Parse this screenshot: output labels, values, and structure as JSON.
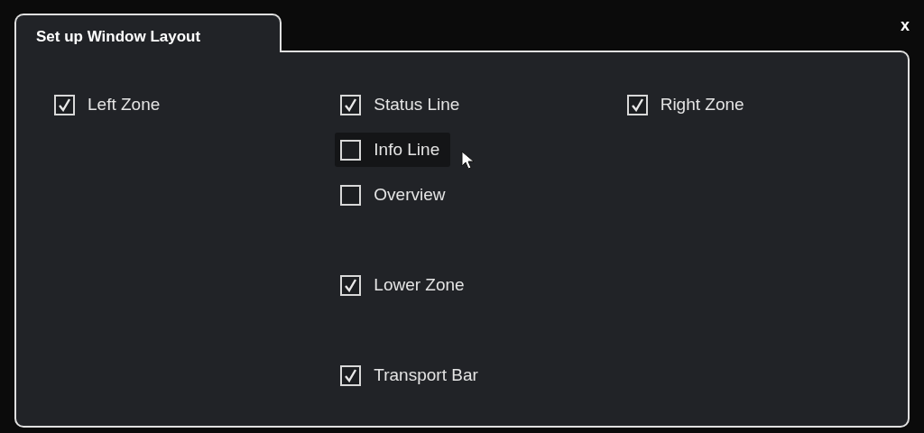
{
  "dialog": {
    "tab": "Set up Window Layout",
    "close": "x"
  },
  "columns": [
    {
      "groups": [
        [
          {
            "label": "Left Zone",
            "checked": true,
            "hovered": false
          }
        ]
      ]
    },
    {
      "groups": [
        [
          {
            "label": "Status Line",
            "checked": true,
            "hovered": false
          },
          {
            "label": "Info Line",
            "checked": false,
            "hovered": true
          },
          {
            "label": "Overview",
            "checked": false,
            "hovered": false
          }
        ],
        [
          {
            "label": "Lower Zone",
            "checked": true,
            "hovered": false
          }
        ],
        [
          {
            "label": "Transport Bar",
            "checked": true,
            "hovered": false
          }
        ]
      ]
    },
    {
      "groups": [
        [
          {
            "label": "Right Zone",
            "checked": true,
            "hovered": false
          }
        ]
      ]
    }
  ]
}
